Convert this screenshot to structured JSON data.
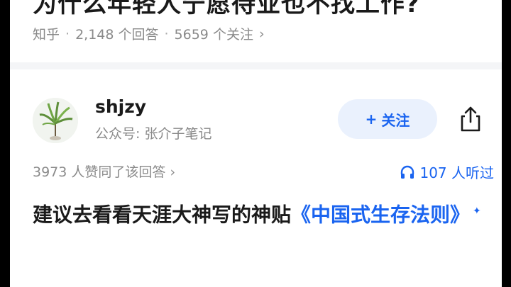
{
  "question": {
    "title": "为什么年轻人宁愿待业也不找工作?",
    "source": "知乎",
    "answers": "2,148 个回答",
    "follows": "5659 个关注",
    "chevron": "›"
  },
  "author": {
    "name": "shjzy",
    "subtitle": "公众号: 张介子笔记",
    "follow_label": "关注",
    "follow_plus": "+",
    "avatar_icon": "plant-avatar",
    "share_icon": "share-icon"
  },
  "stats": {
    "likes": "3973 人赞同了该回答",
    "likes_chevron": "›",
    "listeners": "107 人听过",
    "listen_icon": "headphones-icon"
  },
  "answer": {
    "text": "建议去看看天涯大神写的神贴",
    "link": "《中国式生存法则》",
    "sup": "✦"
  },
  "colors": {
    "accent": "#1a64f0",
    "follow_bg": "#eaf1fd",
    "meta": "#8a8a8a"
  }
}
